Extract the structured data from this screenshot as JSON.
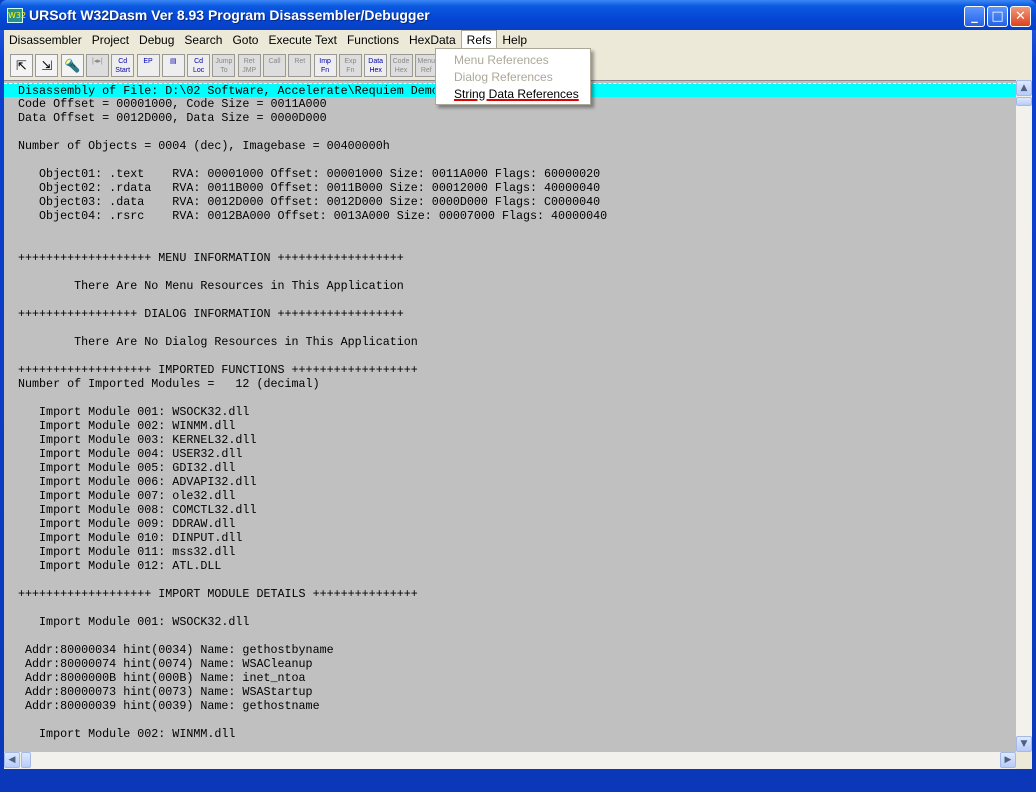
{
  "window": {
    "title": "URSoft W32Dasm Ver 8.93 Program Disassembler/Debugger",
    "app_icon": "W32"
  },
  "menu": [
    "Disassembler",
    "Project",
    "Debug",
    "Search",
    "Goto",
    "Execute Text",
    "Functions",
    "HexData",
    "Refs",
    "Help"
  ],
  "refs_menu": {
    "items": [
      {
        "label": "Menu References",
        "enabled": false
      },
      {
        "label": "Dialog References",
        "enabled": false
      },
      {
        "label": "String Data References",
        "enabled": true
      }
    ]
  },
  "toolbar": [
    {
      "name": "open-file",
      "label": "⇱",
      "state": "icon"
    },
    {
      "name": "save-file",
      "label": "⇲",
      "state": "icon"
    },
    {
      "name": "load-process",
      "label": "🔦",
      "state": "icon"
    },
    {
      "name": "step",
      "label": "|◂▸|",
      "state": "off"
    },
    {
      "name": "cd-start",
      "label": "Cd Start",
      "state": "on"
    },
    {
      "name": "ep",
      "label": "EP",
      "state": "on"
    },
    {
      "name": "goto-offset",
      "label": "▤",
      "state": "on"
    },
    {
      "name": "cd-loc",
      "label": "Cd Loc",
      "state": "on"
    },
    {
      "name": "jump-to",
      "label": "Jump To",
      "state": "off"
    },
    {
      "name": "ret-jmp",
      "label": "Ret JMP",
      "state": "off"
    },
    {
      "name": "call",
      "label": "Call",
      "state": "off"
    },
    {
      "name": "ret",
      "label": "Ret",
      "state": "off"
    },
    {
      "name": "imp-fn",
      "label": "Imp Fn",
      "state": "on"
    },
    {
      "name": "exp-fn",
      "label": "Exp Fn",
      "state": "off"
    },
    {
      "name": "data-hex",
      "label": "Data Hex",
      "state": "on"
    },
    {
      "name": "code-hex",
      "label": "Code Hex",
      "state": "off"
    },
    {
      "name": "menu-ref",
      "label": "Menu Ref",
      "state": "off"
    },
    {
      "name": "dlg-ref",
      "label": "DLG Ref",
      "state": "off"
    }
  ],
  "lines": [
    "Disassembly of File: D:\\02 Software, Accelerate\\Requiem Demo",
    "Code Offset = 00001000, Code Size = 0011A000",
    "Data Offset = 0012D000, Data Size = 0000D000",
    "",
    "Number of Objects = 0004 (dec), Imagebase = 00400000h",
    "",
    "   Object01: .text    RVA: 00001000 Offset: 00001000 Size: 0011A000 Flags: 60000020",
    "   Object02: .rdata   RVA: 0011B000 Offset: 0011B000 Size: 00012000 Flags: 40000040",
    "   Object03: .data    RVA: 0012D000 Offset: 0012D000 Size: 0000D000 Flags: C0000040",
    "   Object04: .rsrc    RVA: 0012BA000 Offset: 0013A000 Size: 00007000 Flags: 40000040",
    "",
    "",
    "+++++++++++++++++++ MENU INFORMATION ++++++++++++++++++",
    "",
    "        There Are No Menu Resources in This Application",
    "",
    "+++++++++++++++++ DIALOG INFORMATION ++++++++++++++++++",
    "",
    "        There Are No Dialog Resources in This Application",
    "",
    "+++++++++++++++++++ IMPORTED FUNCTIONS ++++++++++++++++++",
    "Number of Imported Modules =   12 (decimal)",
    "",
    "   Import Module 001: WSOCK32.dll",
    "   Import Module 002: WINMM.dll",
    "   Import Module 003: KERNEL32.dll",
    "   Import Module 004: USER32.dll",
    "   Import Module 005: GDI32.dll",
    "   Import Module 006: ADVAPI32.dll",
    "   Import Module 007: ole32.dll",
    "   Import Module 008: COMCTL32.dll",
    "   Import Module 009: DDRAW.dll",
    "   Import Module 010: DINPUT.dll",
    "   Import Module 011: mss32.dll",
    "   Import Module 012: ATL.DLL",
    "",
    "+++++++++++++++++++ IMPORT MODULE DETAILS +++++++++++++++",
    "",
    "   Import Module 001: WSOCK32.dll",
    "",
    " Addr:80000034 hint(0034) Name: gethostbyname",
    " Addr:80000074 hint(0074) Name: WSACleanup",
    " Addr:8000000B hint(000B) Name: inet_ntoa",
    " Addr:80000073 hint(0073) Name: WSAStartup",
    " Addr:80000039 hint(0039) Name: gethostname",
    "",
    "   Import Module 002: WINMM.dll"
  ],
  "scroll": {
    "up": "▲",
    "down": "▼",
    "left": "◀",
    "right": "▶"
  },
  "window_buttons": {
    "minimize": "_",
    "maximize": "□",
    "close": "✕"
  }
}
